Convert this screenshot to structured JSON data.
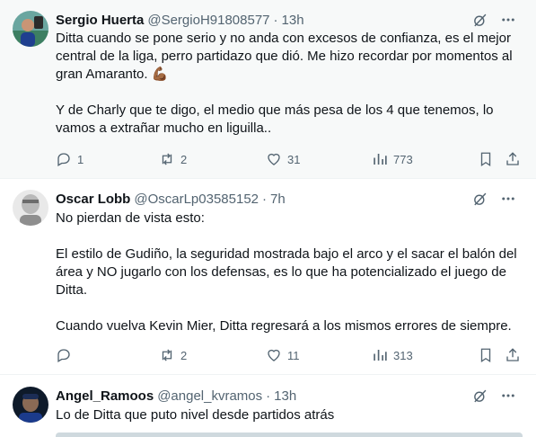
{
  "tweets": [
    {
      "name": "Sergio Huerta",
      "handle": "@SergioH91808577",
      "dot": "·",
      "time": "13h",
      "paragraphs": [
        "Ditta cuando se pone serio y no anda con excesos de confianza, es el mejor central de la liga, perro partidazo que dió. Me hizo recordar por momentos al gran Amaranto. 💪🏾",
        "Y de Charly que te digo, el medio que más pesa de los 4 que tenemos, lo vamos a extrañar mucho en liguilla.."
      ],
      "replies": "1",
      "reposts": "2",
      "likes": "31",
      "views": "773"
    },
    {
      "name": "Oscar Lobb",
      "handle": "@OscarLp03585152",
      "dot": "·",
      "time": "7h",
      "paragraphs": [
        "No pierdan de vista esto:",
        "El estilo de Gudiño, la seguridad mostrada bajo el arco y el sacar el balón del área y NO jugarlo con los defensas, es lo que ha potencializado el juego de Ditta.",
        "Cuando vuelva Kevin Mier, Ditta regresará a los mismos errores de siempre."
      ],
      "replies": "",
      "reposts": "2",
      "likes": "11",
      "views": "313"
    },
    {
      "name": "Angel_Ramoos",
      "handle": "@angel_kvramos",
      "dot": "·",
      "time": "13h",
      "paragraphs": [
        "Lo de Ditta que puto nivel desde partidos atrás"
      ]
    }
  ],
  "icons": {
    "grok": "grok-icon",
    "more": "more-icon",
    "reply": "reply-icon",
    "repost": "repost-icon",
    "like": "like-icon",
    "views": "views-icon",
    "bookmark": "bookmark-icon",
    "share": "share-icon"
  },
  "colors": {
    "text": "#0f1419",
    "secondary": "#536471",
    "hover_bg": "#f7f9f9",
    "divider": "#eff3f4"
  }
}
